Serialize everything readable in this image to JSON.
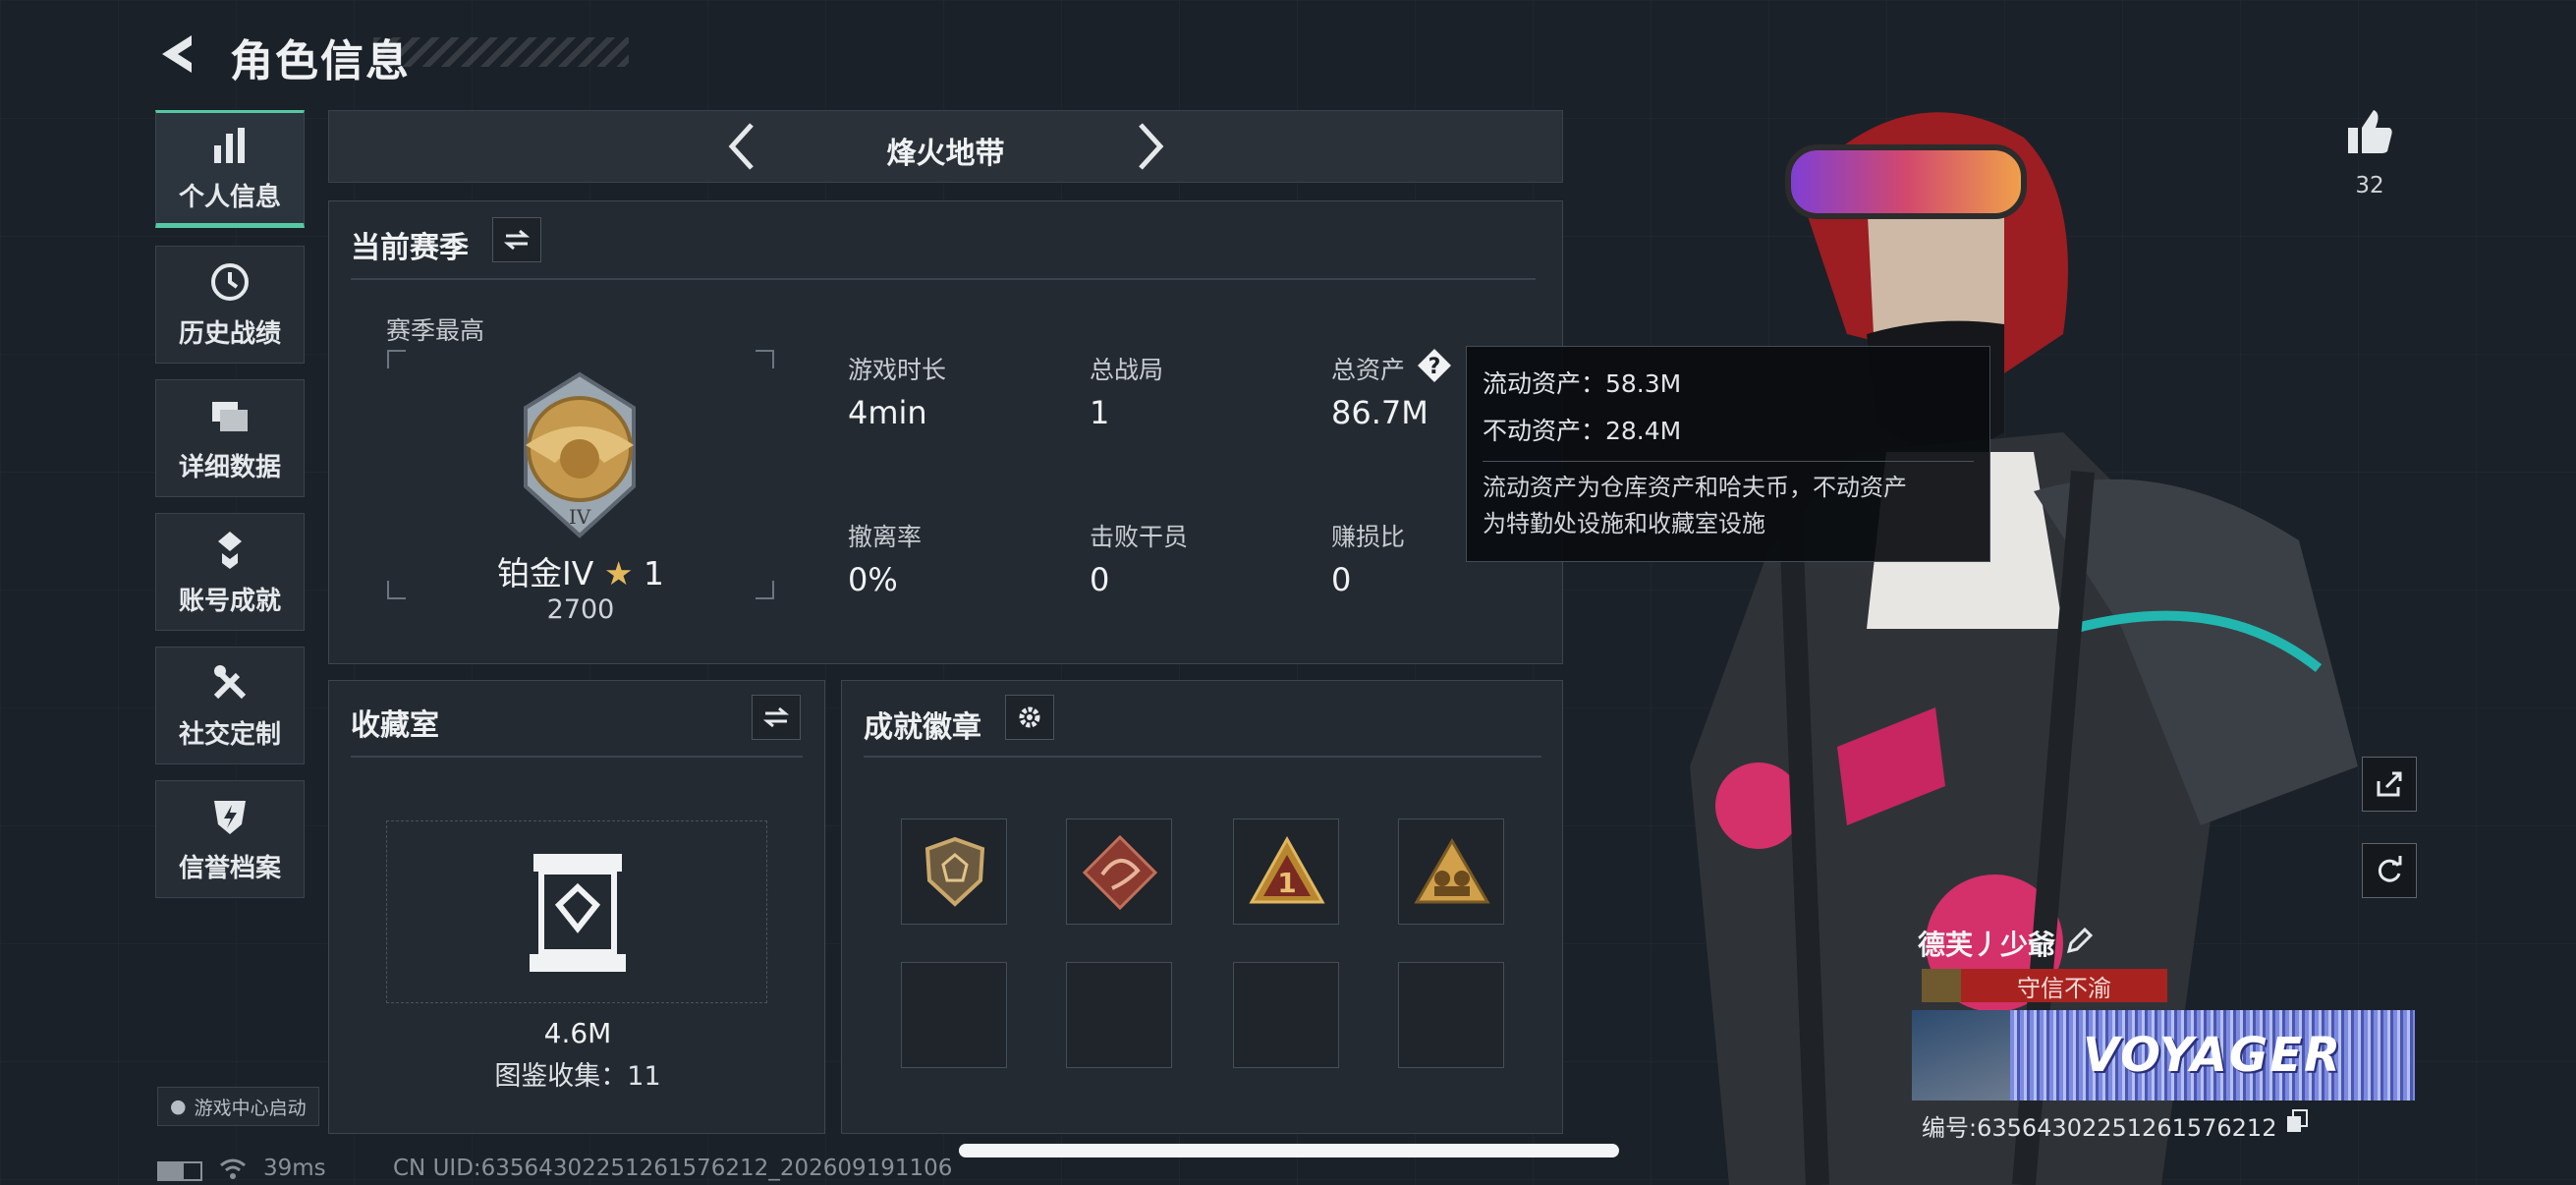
{
  "header": {
    "title": "角色信息"
  },
  "sidebar": {
    "items": [
      {
        "label": "个人信息",
        "icon": "bar-chart-icon"
      },
      {
        "label": "历史战绩",
        "icon": "clock-icon"
      },
      {
        "label": "详细数据",
        "icon": "folder-icon"
      },
      {
        "label": "账号成就",
        "icon": "medal-icon"
      },
      {
        "label": "社交定制",
        "icon": "tools-icon"
      },
      {
        "label": "信誉档案",
        "icon": "shield-bolt-icon"
      }
    ],
    "game_center": "游戏中心启动"
  },
  "mode": {
    "title": "烽火地带"
  },
  "season": {
    "title": "当前赛季",
    "best_label": "赛季最高",
    "rank": "铂金IV",
    "stars": "1",
    "score": "2700",
    "stats": [
      {
        "label": "游戏时长",
        "value": "4min"
      },
      {
        "label": "总战局",
        "value": "1"
      },
      {
        "label": "总资产",
        "value": "86.7M"
      },
      {
        "label": "撤离率",
        "value": "0%"
      },
      {
        "label": "击败干员",
        "value": "0"
      },
      {
        "label": "赚损比",
        "value": "0"
      }
    ]
  },
  "tooltip": {
    "liquid": "流动资产：58.3M",
    "fixed": "不动资产：28.4M",
    "note1": "流动资产为仓库资产和哈夫币，不动资产",
    "note2": "为特勤处设施和收藏室设施"
  },
  "collection": {
    "title": "收藏室",
    "value": "4.6M",
    "count_text": "图鉴收集：11"
  },
  "achievements": {
    "title": "成就徽章"
  },
  "profile": {
    "likes": "32",
    "name": "德芙丿少爺",
    "title_badge": "守信不渝",
    "banner_text": "VOYAGER",
    "uid_text": "编号:6356430225126157621​2"
  },
  "status": {
    "ping": "39ms",
    "uid_line": "CN UID:6356430225126157621​2_202609191106"
  },
  "colors": {
    "accent": "#56c9a3",
    "badge_red": "#a8231f"
  }
}
